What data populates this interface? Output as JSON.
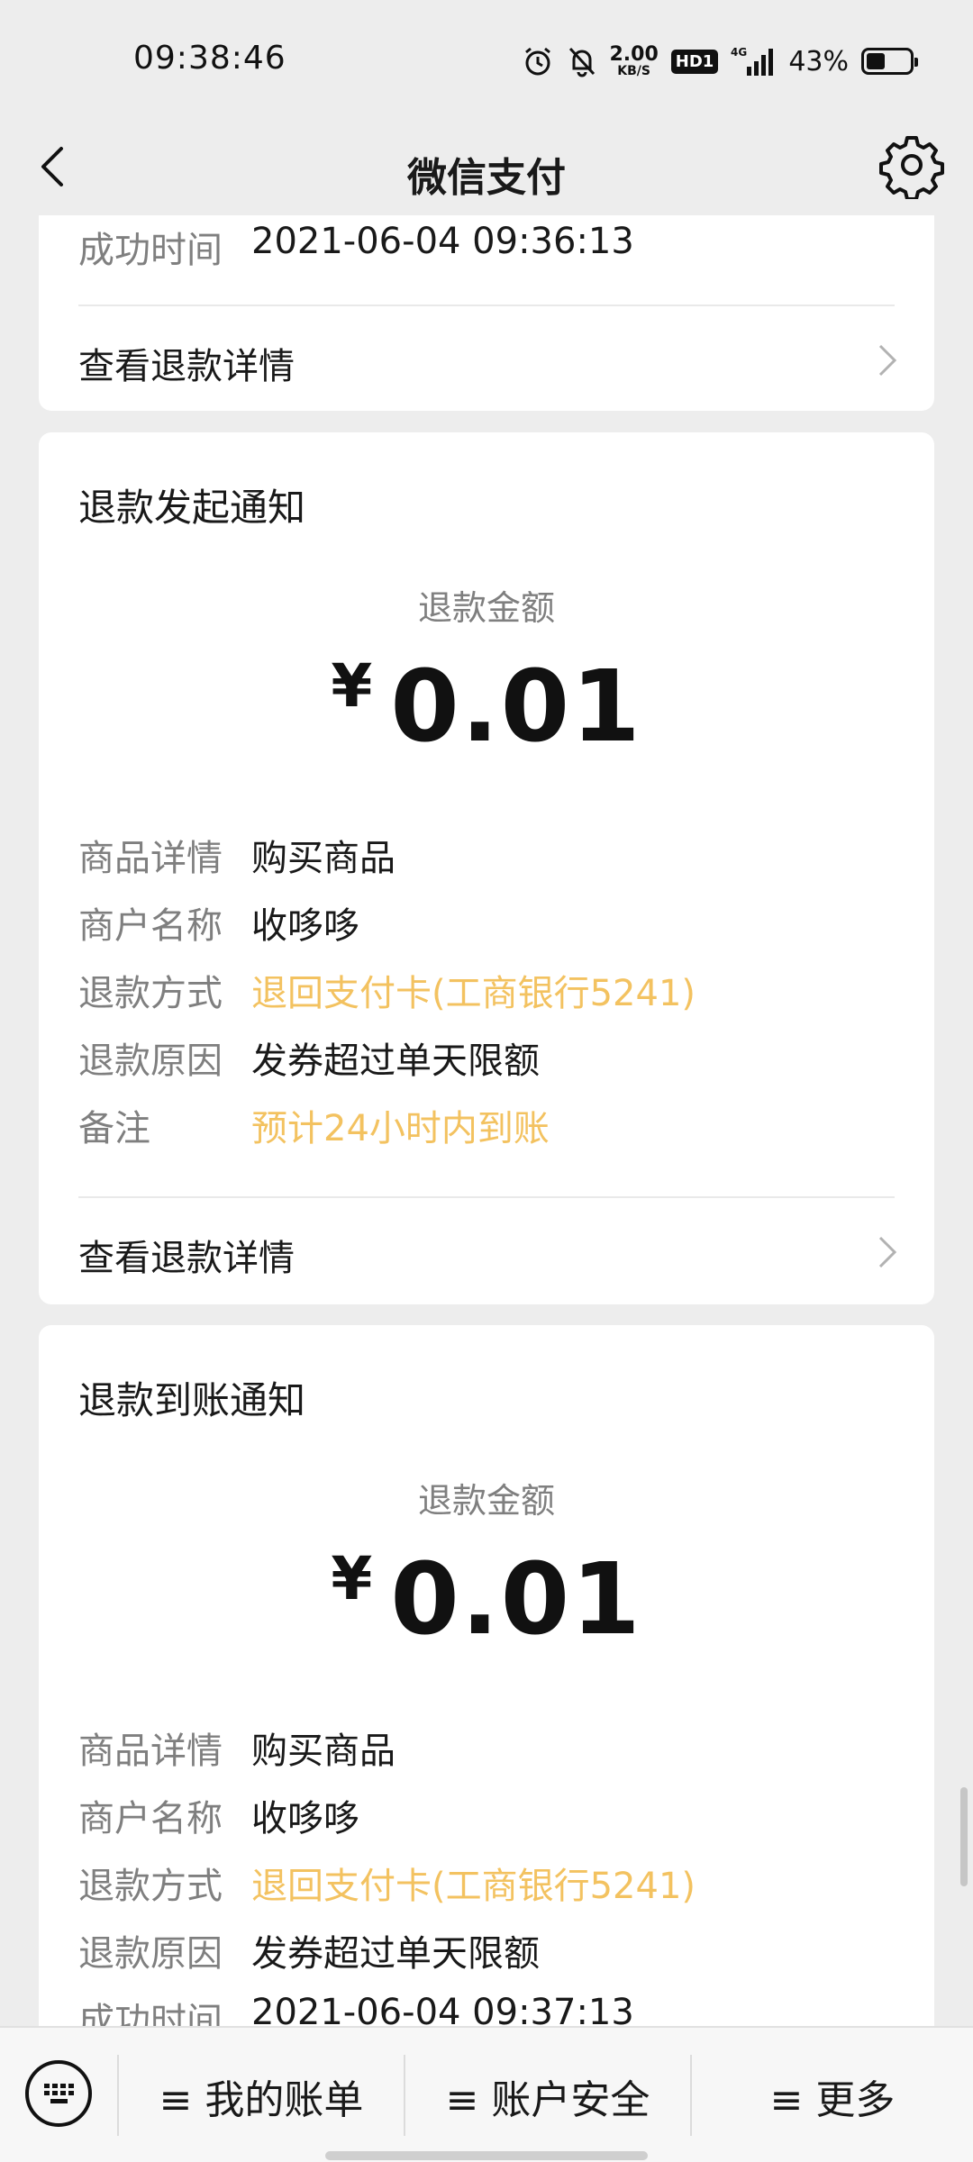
{
  "status_bar": {
    "time": "09:38:46",
    "net_speed_value": "2.00",
    "net_speed_unit": "KB/S",
    "hd": "HD1",
    "network": "4G",
    "battery": "43%",
    "battery_level": 0.43
  },
  "nav": {
    "title": "微信支付"
  },
  "card_top": {
    "rows": [
      {
        "key": "成功时间",
        "value": "2021-06-04 09:36:13"
      }
    ],
    "link": "查看退款详情"
  },
  "card_refund_initiated": {
    "title": "退款发起通知",
    "amount_label": "退款金额",
    "currency": "¥",
    "amount": "0.01",
    "rows": [
      {
        "key": "商品详情",
        "value": "购买商品"
      },
      {
        "key": "商户名称",
        "value": "收哆哆"
      },
      {
        "key": "退款方式",
        "value": "退回支付卡(工商银行5241)"
      },
      {
        "key": "退款原因",
        "value": "发券超过单天限额"
      },
      {
        "key": "备注",
        "value": "预计24小时内到账"
      }
    ],
    "link": "查看退款详情"
  },
  "card_refund_received": {
    "title": "退款到账通知",
    "amount_label": "退款金额",
    "currency": "¥",
    "amount": "0.01",
    "rows": [
      {
        "key": "商品详情",
        "value": "购买商品"
      },
      {
        "key": "商户名称",
        "value": "收哆哆"
      },
      {
        "key": "退款方式",
        "value": "退回支付卡(工商银行5241)"
      },
      {
        "key": "退款原因",
        "value": "发券超过单天限额"
      },
      {
        "key": "成功时间",
        "value": "2021-06-04 09:37:13"
      }
    ]
  },
  "colors": {
    "highlight": "#f3c260",
    "background": "#ededed"
  },
  "bottom_bar": {
    "items": [
      {
        "label": "≡ 我的账单"
      },
      {
        "label": "≡ 账户安全"
      },
      {
        "label": "≡ 更多"
      }
    ]
  }
}
